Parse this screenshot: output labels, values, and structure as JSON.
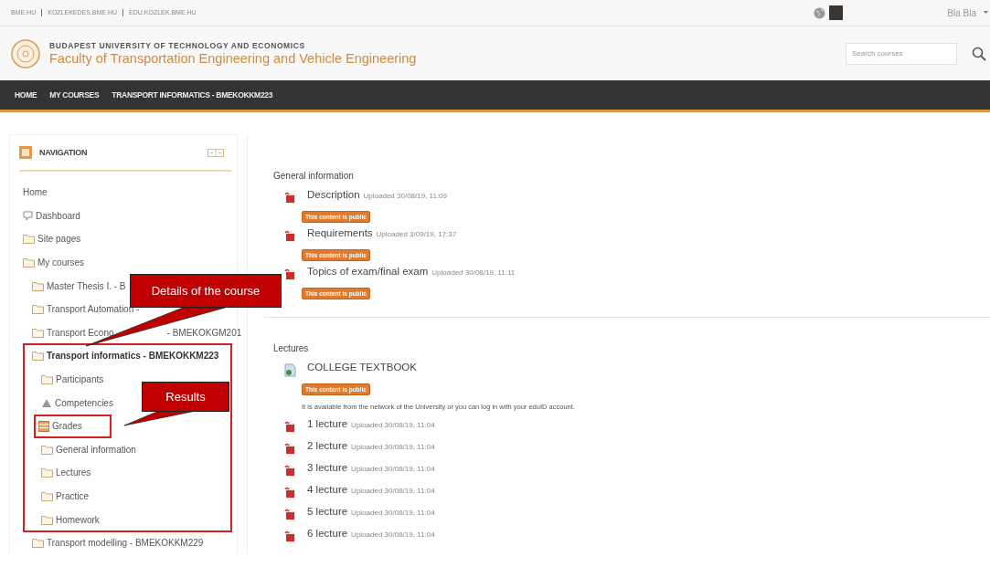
{
  "top_bar": {
    "links": [
      "BME.HU",
      "KOZLEKEDES.BME.HU",
      "EDU.KOZLEK.BME.HU"
    ],
    "user_name": "Bla Bla"
  },
  "header": {
    "university": "BUDAPEST UNIVERSITY OF TECHNOLOGY AND ECONOMICS",
    "faculty": "Faculty of Transportation Engineering and Vehicle Engineering",
    "search": {
      "placeholder": "Search courses"
    }
  },
  "breadcrumb": [
    "HOME",
    "MY COURSES",
    "TRANSPORT INFORMATICS - BMEKOKKM223"
  ],
  "navigation": {
    "title": "NAVIGATION",
    "items": [
      {
        "label": "Home",
        "kind": "plain",
        "highlighted": false
      },
      {
        "label": "Dashboard",
        "kind": "dashboard",
        "highlighted": false
      },
      {
        "label": "Site pages",
        "kind": "folder",
        "highlighted": false
      },
      {
        "label": "My courses",
        "kind": "folder",
        "highlighted": false,
        "children": [
          {
            "label": "Master Thesis I. - B",
            "kind": "folder",
            "highlighted": false
          },
          {
            "label": "Transport Automation -",
            "kind": "folder",
            "highlighted": false
          },
          {
            "label": "Transport Econo",
            "label_tail": "- BMEKOKGM201",
            "kind": "folder",
            "highlighted": false
          },
          {
            "label": "Transport informatics - BMEKOKKM223",
            "kind": "folder",
            "highlighted": true,
            "children": [
              {
                "label": "Participants",
                "kind": "folder",
                "highlighted": false
              },
              {
                "label": "Competencies",
                "kind": "competency",
                "highlighted": false
              },
              {
                "label": "Grades",
                "kind": "grades",
                "highlighted": true
              },
              {
                "label": "General information",
                "kind": "folder",
                "highlighted": false
              },
              {
                "label": "Lectures",
                "kind": "folder",
                "highlighted": false
              },
              {
                "label": "Practice",
                "kind": "folder",
                "highlighted": false
              },
              {
                "label": "Homework",
                "kind": "folder",
                "highlighted": false
              }
            ]
          },
          {
            "label": "Transport modelling - BMEKOKKM229",
            "kind": "folder",
            "highlighted": false
          }
        ]
      }
    ]
  },
  "callouts": [
    {
      "text": "Details of the course",
      "kind": "course"
    },
    {
      "text": "Results",
      "kind": "grades"
    }
  ],
  "sections": [
    {
      "title": "General information",
      "items": [
        {
          "kind": "file",
          "title": "Description",
          "uploaded": "Uploaded 30/08/19, 11:09",
          "badge": "This content is public"
        },
        {
          "kind": "file",
          "title": "Requirements",
          "uploaded": "Uploaded 3/09/19, 17:37",
          "badge": "This content is public"
        },
        {
          "kind": "file",
          "title": "Topics of exam/final exam",
          "uploaded": "Uploaded 30/08/19, 11:11",
          "badge": "This content is public"
        }
      ]
    },
    {
      "title": "Lectures",
      "items": [
        {
          "kind": "url",
          "title": "COLLEGE TEXTBOOK",
          "badge": "This content is public",
          "description": "It is available from the network of the University or you can log in with your eduID account."
        },
        {
          "kind": "file",
          "title": "1 lecture",
          "uploaded": "Uploaded 30/08/19, 11:04"
        },
        {
          "kind": "file",
          "title": "2 lecture",
          "uploaded": "Uploaded 30/08/19, 11:04"
        },
        {
          "kind": "file",
          "title": "3 lecture",
          "uploaded": "Uploaded 30/08/19, 11:04"
        },
        {
          "kind": "file",
          "title": "4 lecture",
          "uploaded": "Uploaded 30/08/19, 11:04"
        },
        {
          "kind": "file",
          "title": "5 lecture",
          "uploaded": "Uploaded 30/08/19, 11:04"
        },
        {
          "kind": "file",
          "title": "6 lecture",
          "uploaded": "Uploaded 30/08/19, 11:04"
        }
      ]
    }
  ]
}
